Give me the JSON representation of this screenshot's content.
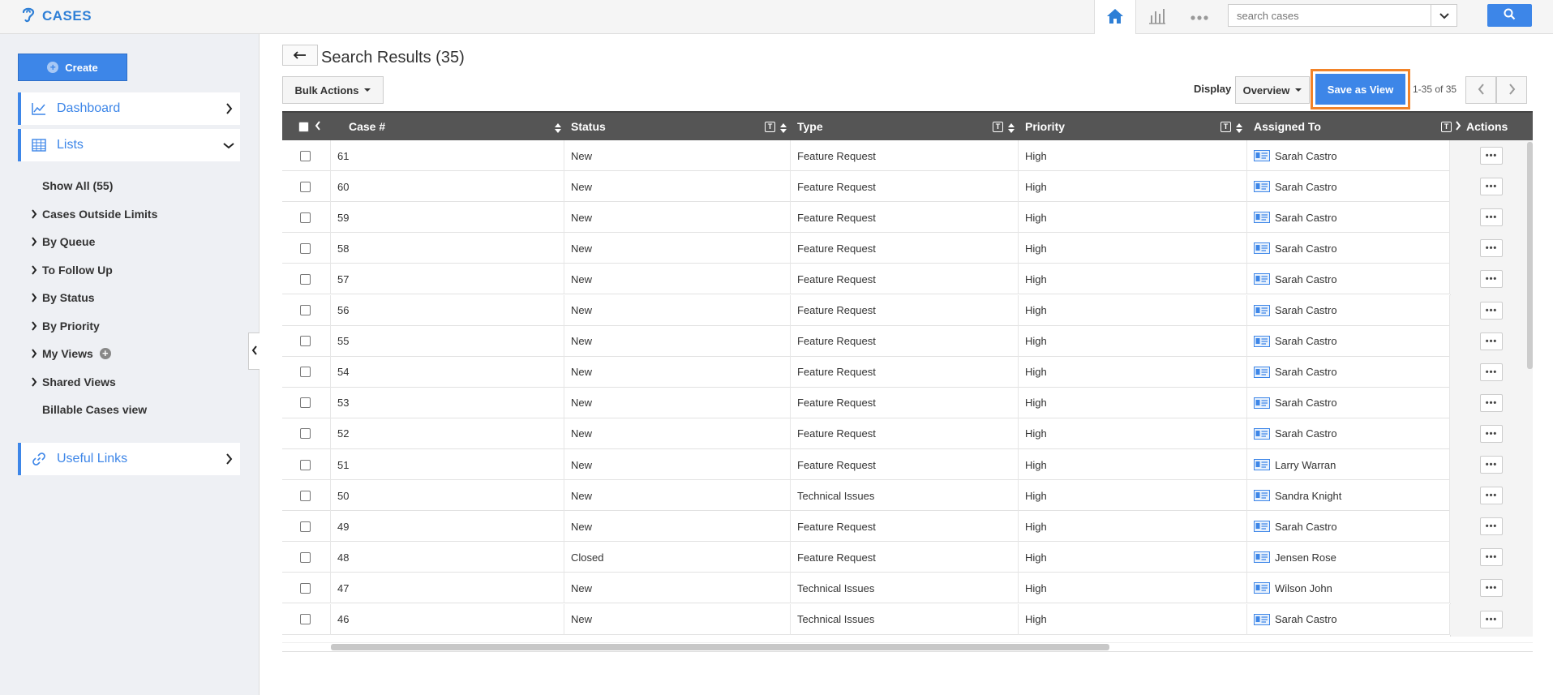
{
  "app": {
    "title": "CASES"
  },
  "search": {
    "placeholder": "search cases"
  },
  "sidebar": {
    "create_label": "Create",
    "dashboard_label": "Dashboard",
    "lists_label": "Lists",
    "useful_links_label": "Useful Links",
    "items": [
      {
        "label": "Show All (55)",
        "expandable": false
      },
      {
        "label": "Cases Outside Limits",
        "expandable": true
      },
      {
        "label": "By Queue",
        "expandable": true
      },
      {
        "label": "To Follow Up",
        "expandable": true
      },
      {
        "label": "By Status",
        "expandable": true
      },
      {
        "label": "By Priority",
        "expandable": true
      },
      {
        "label": "My Views",
        "expandable": true
      },
      {
        "label": "Shared Views",
        "expandable": true
      },
      {
        "label": "Billable Cases view",
        "expandable": false
      }
    ]
  },
  "main": {
    "title": "Search Results (35)",
    "bulk_actions_label": "Bulk Actions",
    "display_label": "Display",
    "display_value": "Overview",
    "save_view_label": "Save as View",
    "pagination_text": "1-35 of 35"
  },
  "table": {
    "columns": [
      "Case #",
      "Status",
      "Type",
      "Priority",
      "Assigned To",
      "Actions"
    ],
    "filter_glyph": "T",
    "rows": [
      {
        "case": "61",
        "status": "New",
        "type": "Feature Request",
        "priority": "High",
        "assigned": "Sarah Castro"
      },
      {
        "case": "60",
        "status": "New",
        "type": "Feature Request",
        "priority": "High",
        "assigned": "Sarah Castro"
      },
      {
        "case": "59",
        "status": "New",
        "type": "Feature Request",
        "priority": "High",
        "assigned": "Sarah Castro"
      },
      {
        "case": "58",
        "status": "New",
        "type": "Feature Request",
        "priority": "High",
        "assigned": "Sarah Castro"
      },
      {
        "case": "57",
        "status": "New",
        "type": "Feature Request",
        "priority": "High",
        "assigned": "Sarah Castro"
      },
      {
        "case": "56",
        "status": "New",
        "type": "Feature Request",
        "priority": "High",
        "assigned": "Sarah Castro"
      },
      {
        "case": "55",
        "status": "New",
        "type": "Feature Request",
        "priority": "High",
        "assigned": "Sarah Castro"
      },
      {
        "case": "54",
        "status": "New",
        "type": "Feature Request",
        "priority": "High",
        "assigned": "Sarah Castro"
      },
      {
        "case": "53",
        "status": "New",
        "type": "Feature Request",
        "priority": "High",
        "assigned": "Sarah Castro"
      },
      {
        "case": "52",
        "status": "New",
        "type": "Feature Request",
        "priority": "High",
        "assigned": "Sarah Castro"
      },
      {
        "case": "51",
        "status": "New",
        "type": "Feature Request",
        "priority": "High",
        "assigned": "Larry Warran"
      },
      {
        "case": "50",
        "status": "New",
        "type": "Technical Issues",
        "priority": "High",
        "assigned": "Sandra Knight"
      },
      {
        "case": "49",
        "status": "New",
        "type": "Feature Request",
        "priority": "High",
        "assigned": "Sarah Castro"
      },
      {
        "case": "48",
        "status": "Closed",
        "type": "Feature Request",
        "priority": "High",
        "assigned": "Jensen Rose"
      },
      {
        "case": "47",
        "status": "New",
        "type": "Technical Issues",
        "priority": "High",
        "assigned": "Wilson John"
      },
      {
        "case": "46",
        "status": "New",
        "type": "Technical Issues",
        "priority": "High",
        "assigned": "Sarah Castro"
      }
    ]
  },
  "colors": {
    "accent": "#3d86e8",
    "highlight": "#f28328",
    "header_bg": "#555555",
    "sidebar_bg": "#eef0f4"
  }
}
